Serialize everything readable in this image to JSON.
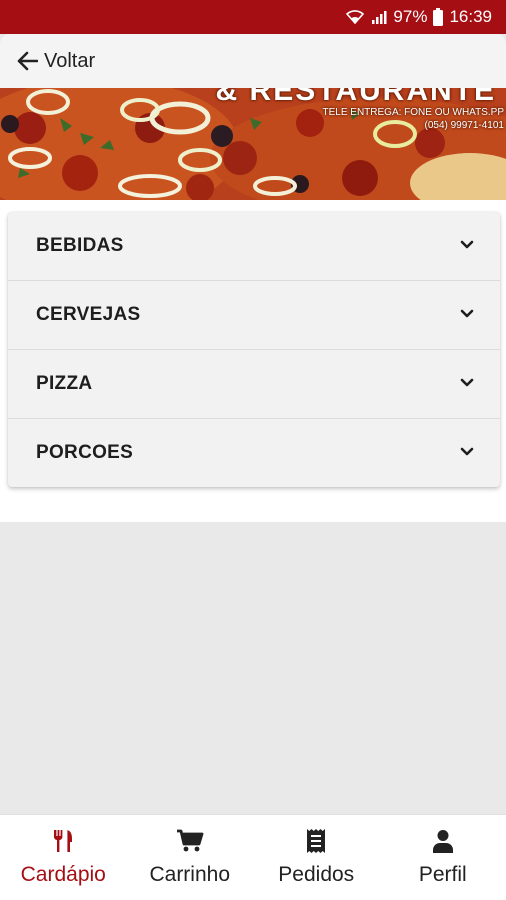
{
  "status_bar": {
    "battery": "97%",
    "time": "16:39",
    "wifi_icon": "wifi-icon",
    "signal_icon": "signal-icon",
    "battery_icon": "battery-icon"
  },
  "header": {
    "back_label": "Voltar",
    "back_icon": "arrow-left-icon"
  },
  "banner": {
    "title_fragment": "& RESTAURANTE",
    "line1": "TELE ENTREGA: FONE OU WHATS.PP",
    "line2": "(054) 99971-4101"
  },
  "menu": {
    "categories": [
      {
        "label": "BEBIDAS"
      },
      {
        "label": "CERVEJAS"
      },
      {
        "label": "PIZZA"
      },
      {
        "label": "PORCOES"
      }
    ]
  },
  "bottom_nav": {
    "items": [
      {
        "label": "Cardápio",
        "icon": "utensils-icon",
        "active": true
      },
      {
        "label": "Carrinho",
        "icon": "cart-icon",
        "active": false
      },
      {
        "label": "Pedidos",
        "icon": "receipt-icon",
        "active": false
      },
      {
        "label": "Perfil",
        "icon": "user-icon",
        "active": false
      }
    ]
  },
  "colors": {
    "brand": "#a50f14",
    "active_nav": "#a50f14",
    "header_bg": "#f4f4f4",
    "page_bg": "#e9e9e9"
  }
}
